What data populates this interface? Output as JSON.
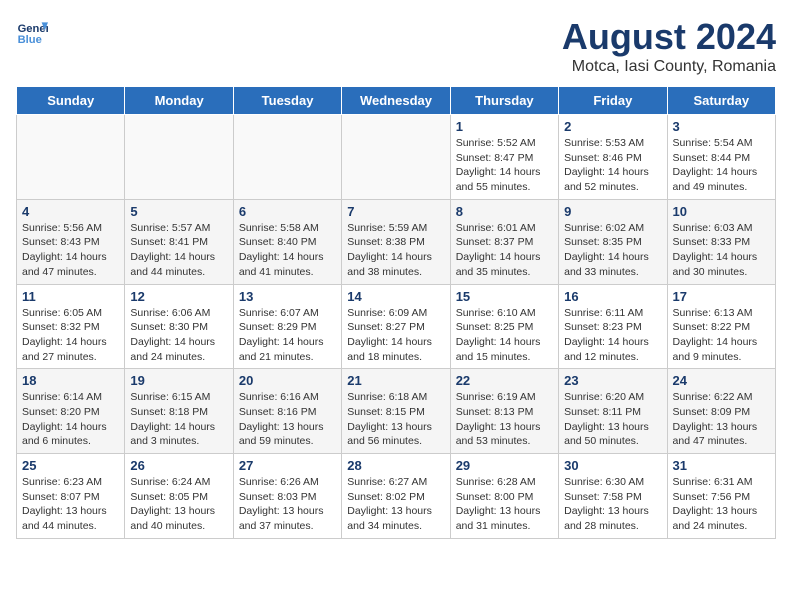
{
  "header": {
    "logo_line1": "General",
    "logo_line2": "Blue",
    "month": "August 2024",
    "location": "Motca, Iasi County, Romania"
  },
  "days_of_week": [
    "Sunday",
    "Monday",
    "Tuesday",
    "Wednesday",
    "Thursday",
    "Friday",
    "Saturday"
  ],
  "weeks": [
    [
      {
        "day": "",
        "details": ""
      },
      {
        "day": "",
        "details": ""
      },
      {
        "day": "",
        "details": ""
      },
      {
        "day": "",
        "details": ""
      },
      {
        "day": "1",
        "details": "Sunrise: 5:52 AM\nSunset: 8:47 PM\nDaylight: 14 hours\nand 55 minutes."
      },
      {
        "day": "2",
        "details": "Sunrise: 5:53 AM\nSunset: 8:46 PM\nDaylight: 14 hours\nand 52 minutes."
      },
      {
        "day": "3",
        "details": "Sunrise: 5:54 AM\nSunset: 8:44 PM\nDaylight: 14 hours\nand 49 minutes."
      }
    ],
    [
      {
        "day": "4",
        "details": "Sunrise: 5:56 AM\nSunset: 8:43 PM\nDaylight: 14 hours\nand 47 minutes."
      },
      {
        "day": "5",
        "details": "Sunrise: 5:57 AM\nSunset: 8:41 PM\nDaylight: 14 hours\nand 44 minutes."
      },
      {
        "day": "6",
        "details": "Sunrise: 5:58 AM\nSunset: 8:40 PM\nDaylight: 14 hours\nand 41 minutes."
      },
      {
        "day": "7",
        "details": "Sunrise: 5:59 AM\nSunset: 8:38 PM\nDaylight: 14 hours\nand 38 minutes."
      },
      {
        "day": "8",
        "details": "Sunrise: 6:01 AM\nSunset: 8:37 PM\nDaylight: 14 hours\nand 35 minutes."
      },
      {
        "day": "9",
        "details": "Sunrise: 6:02 AM\nSunset: 8:35 PM\nDaylight: 14 hours\nand 33 minutes."
      },
      {
        "day": "10",
        "details": "Sunrise: 6:03 AM\nSunset: 8:33 PM\nDaylight: 14 hours\nand 30 minutes."
      }
    ],
    [
      {
        "day": "11",
        "details": "Sunrise: 6:05 AM\nSunset: 8:32 PM\nDaylight: 14 hours\nand 27 minutes."
      },
      {
        "day": "12",
        "details": "Sunrise: 6:06 AM\nSunset: 8:30 PM\nDaylight: 14 hours\nand 24 minutes."
      },
      {
        "day": "13",
        "details": "Sunrise: 6:07 AM\nSunset: 8:29 PM\nDaylight: 14 hours\nand 21 minutes."
      },
      {
        "day": "14",
        "details": "Sunrise: 6:09 AM\nSunset: 8:27 PM\nDaylight: 14 hours\nand 18 minutes."
      },
      {
        "day": "15",
        "details": "Sunrise: 6:10 AM\nSunset: 8:25 PM\nDaylight: 14 hours\nand 15 minutes."
      },
      {
        "day": "16",
        "details": "Sunrise: 6:11 AM\nSunset: 8:23 PM\nDaylight: 14 hours\nand 12 minutes."
      },
      {
        "day": "17",
        "details": "Sunrise: 6:13 AM\nSunset: 8:22 PM\nDaylight: 14 hours\nand 9 minutes."
      }
    ],
    [
      {
        "day": "18",
        "details": "Sunrise: 6:14 AM\nSunset: 8:20 PM\nDaylight: 14 hours\nand 6 minutes."
      },
      {
        "day": "19",
        "details": "Sunrise: 6:15 AM\nSunset: 8:18 PM\nDaylight: 14 hours\nand 3 minutes."
      },
      {
        "day": "20",
        "details": "Sunrise: 6:16 AM\nSunset: 8:16 PM\nDaylight: 13 hours\nand 59 minutes."
      },
      {
        "day": "21",
        "details": "Sunrise: 6:18 AM\nSunset: 8:15 PM\nDaylight: 13 hours\nand 56 minutes."
      },
      {
        "day": "22",
        "details": "Sunrise: 6:19 AM\nSunset: 8:13 PM\nDaylight: 13 hours\nand 53 minutes."
      },
      {
        "day": "23",
        "details": "Sunrise: 6:20 AM\nSunset: 8:11 PM\nDaylight: 13 hours\nand 50 minutes."
      },
      {
        "day": "24",
        "details": "Sunrise: 6:22 AM\nSunset: 8:09 PM\nDaylight: 13 hours\nand 47 minutes."
      }
    ],
    [
      {
        "day": "25",
        "details": "Sunrise: 6:23 AM\nSunset: 8:07 PM\nDaylight: 13 hours\nand 44 minutes."
      },
      {
        "day": "26",
        "details": "Sunrise: 6:24 AM\nSunset: 8:05 PM\nDaylight: 13 hours\nand 40 minutes."
      },
      {
        "day": "27",
        "details": "Sunrise: 6:26 AM\nSunset: 8:03 PM\nDaylight: 13 hours\nand 37 minutes."
      },
      {
        "day": "28",
        "details": "Sunrise: 6:27 AM\nSunset: 8:02 PM\nDaylight: 13 hours\nand 34 minutes."
      },
      {
        "day": "29",
        "details": "Sunrise: 6:28 AM\nSunset: 8:00 PM\nDaylight: 13 hours\nand 31 minutes."
      },
      {
        "day": "30",
        "details": "Sunrise: 6:30 AM\nSunset: 7:58 PM\nDaylight: 13 hours\nand 28 minutes."
      },
      {
        "day": "31",
        "details": "Sunrise: 6:31 AM\nSunset: 7:56 PM\nDaylight: 13 hours\nand 24 minutes."
      }
    ]
  ]
}
